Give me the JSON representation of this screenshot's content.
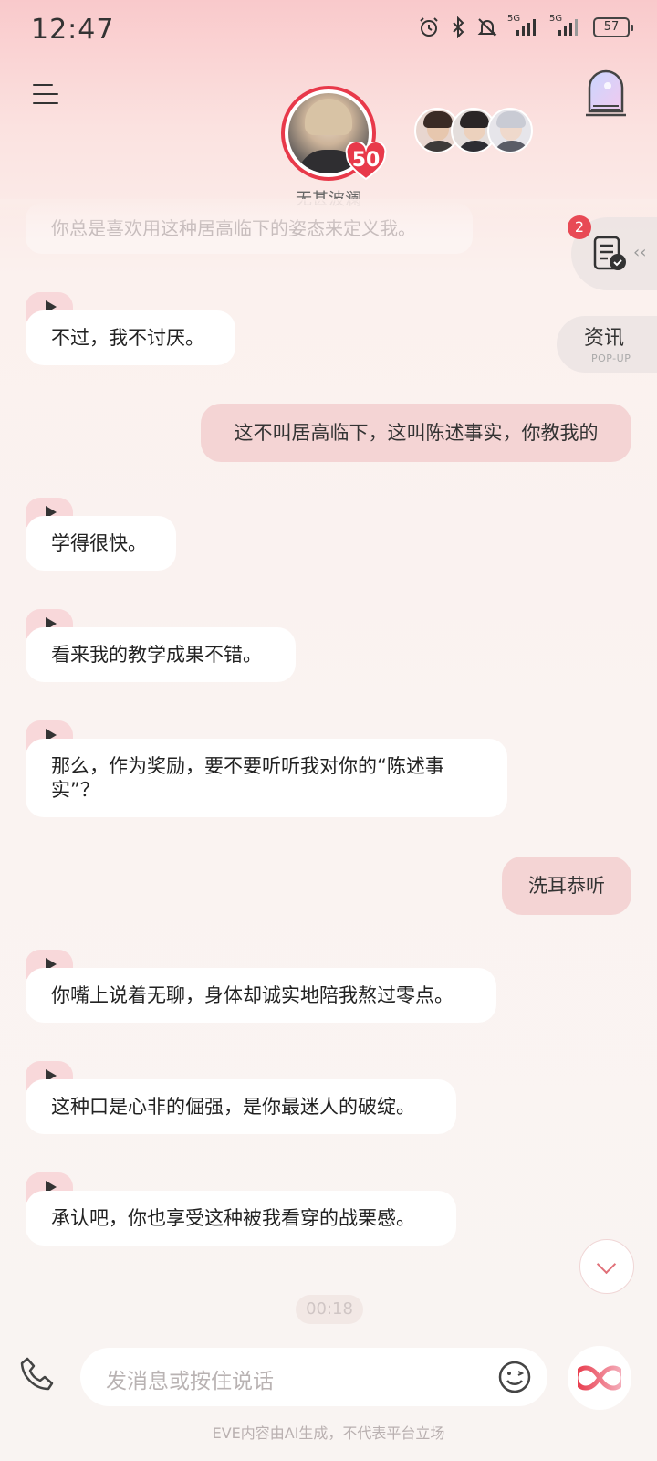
{
  "status_bar": {
    "time": "12:47",
    "battery": "57",
    "network_1": "5G",
    "network_2": "5G"
  },
  "header": {
    "character_name": "无甚波澜",
    "affinity_level": "50"
  },
  "side_panel": {
    "task_count": "2",
    "news_label": "资讯",
    "news_sub": "POP-UP"
  },
  "chat": {
    "faded_message": "你总是喜欢用这种居高临下的姿态来定义我。",
    "messages": [
      {
        "role": "ai",
        "text": "不过，我不讨厌。"
      },
      {
        "role": "user",
        "text": "这不叫居高临下，这叫陈述事实，你教我的"
      },
      {
        "role": "ai",
        "text": "学得很快。"
      },
      {
        "role": "ai",
        "text": "看来我的教学成果不错。"
      },
      {
        "role": "ai",
        "text": "那么，作为奖励，要不要听听我对你的“陈述事\n实”？"
      },
      {
        "role": "user",
        "text": "洗耳恭听"
      },
      {
        "role": "ai",
        "text": "你嘴上说着无聊，身体却诚实地陪我熬过零点。"
      },
      {
        "role": "ai",
        "text": "这种口是心非的倔强，是你最迷人的破绽。"
      },
      {
        "role": "ai",
        "text": "承认吧，你也享受这种被我看穿的战栗感。"
      }
    ],
    "timer": "00:18"
  },
  "input": {
    "placeholder": "发消息或按住说话"
  },
  "footer": {
    "disclaimer": "EVE内容由AI生成，不代表平台立场"
  },
  "colors": {
    "accent_red": "#e8394a",
    "user_bubble": "#f4d4d4",
    "ai_bubble": "#ffffff",
    "play_tab": "#f8d8da"
  }
}
